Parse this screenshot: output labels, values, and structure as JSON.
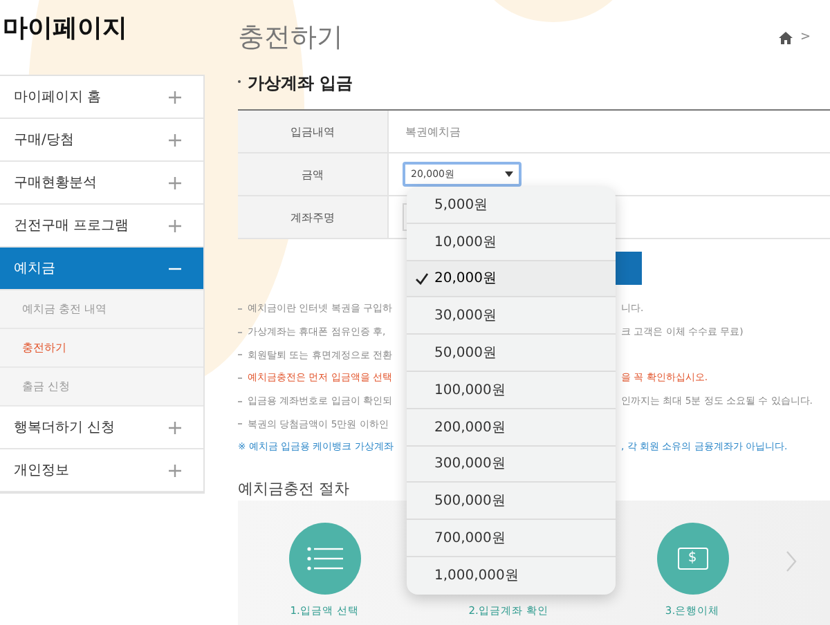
{
  "sidebar": {
    "title": "마이페이지",
    "items": [
      {
        "label": "마이페이지 홈",
        "expanded": false,
        "selected": false
      },
      {
        "label": "구매/당첨",
        "expanded": false,
        "selected": false
      },
      {
        "label": "구매현황분석",
        "expanded": false,
        "selected": false
      },
      {
        "label": "건전구매 프로그램",
        "expanded": false,
        "selected": false
      },
      {
        "label": "예치금",
        "expanded": true,
        "selected": true,
        "children": [
          {
            "label": "예치금 충전 내역",
            "selected": false
          },
          {
            "label": "충전하기",
            "selected": true
          },
          {
            "label": "출금 신청",
            "selected": false
          }
        ]
      },
      {
        "label": "행복더하기 신청",
        "expanded": false,
        "selected": false
      },
      {
        "label": "개인정보",
        "expanded": false,
        "selected": false
      }
    ]
  },
  "page": {
    "title": "충전하기",
    "breadcrumb": ">"
  },
  "section": {
    "title": "가상계좌 입금",
    "rows": [
      {
        "kind": "text",
        "label": "입금내역",
        "value": "복권예치금"
      },
      {
        "kind": "select",
        "label": "금액",
        "value": "20,000원"
      },
      {
        "kind": "empty",
        "label": "계좌주명"
      }
    ]
  },
  "notes": [
    {
      "kind": "normal",
      "left": "예치금이란 인터넷 복권을 구입하",
      "right": "니다."
    },
    {
      "kind": "normal",
      "left": "가상계좌는 휴대폰 점유인증 후,",
      "right": "크 고객은 이체 수수료 무료)"
    },
    {
      "kind": "normal",
      "left": "회원탈퇴 또는 휴면계정으로 전환"
    },
    {
      "kind": "red",
      "left": "예치금충전은 먼저 입금액을 선택",
      "right": "을 꼭 확인하십시오."
    },
    {
      "kind": "normal",
      "left": "입금용 계좌번호로 입금이 확인되",
      "right": "인까지는 최대 5분 정도 소요될 수 있습니다."
    },
    {
      "kind": "normal",
      "left": "복권의 당첨금액이 5만원 이하인"
    },
    {
      "kind": "blue",
      "left": "※ 예치금 입금용 케이뱅크 가상계좌",
      "right": ", 각 회원 소유의 금융계좌가 아닙니다."
    }
  ],
  "procedure": {
    "title": "예치금충전 절차",
    "steps": [
      {
        "kind": "list",
        "label": "1.입금액 선택"
      },
      {
        "kind": "hidden",
        "label": "2.입금계좌 확인"
      },
      {
        "kind": "money",
        "label": "3.은행이체",
        "symbol": "$"
      }
    ]
  },
  "dropdown": {
    "options": [
      {
        "label": "5,000원",
        "selected": false
      },
      {
        "label": "10,000원",
        "selected": false
      },
      {
        "label": "20,000원",
        "selected": true
      },
      {
        "label": "30,000원",
        "selected": false
      },
      {
        "label": "50,000원",
        "selected": false
      },
      {
        "label": "100,000원",
        "selected": false
      },
      {
        "label": "200,000원",
        "selected": false
      },
      {
        "label": "300,000원",
        "selected": false
      },
      {
        "label": "500,000원",
        "selected": false
      },
      {
        "label": "700,000원",
        "selected": false
      },
      {
        "label": "1,000,000원",
        "selected": false
      }
    ]
  }
}
